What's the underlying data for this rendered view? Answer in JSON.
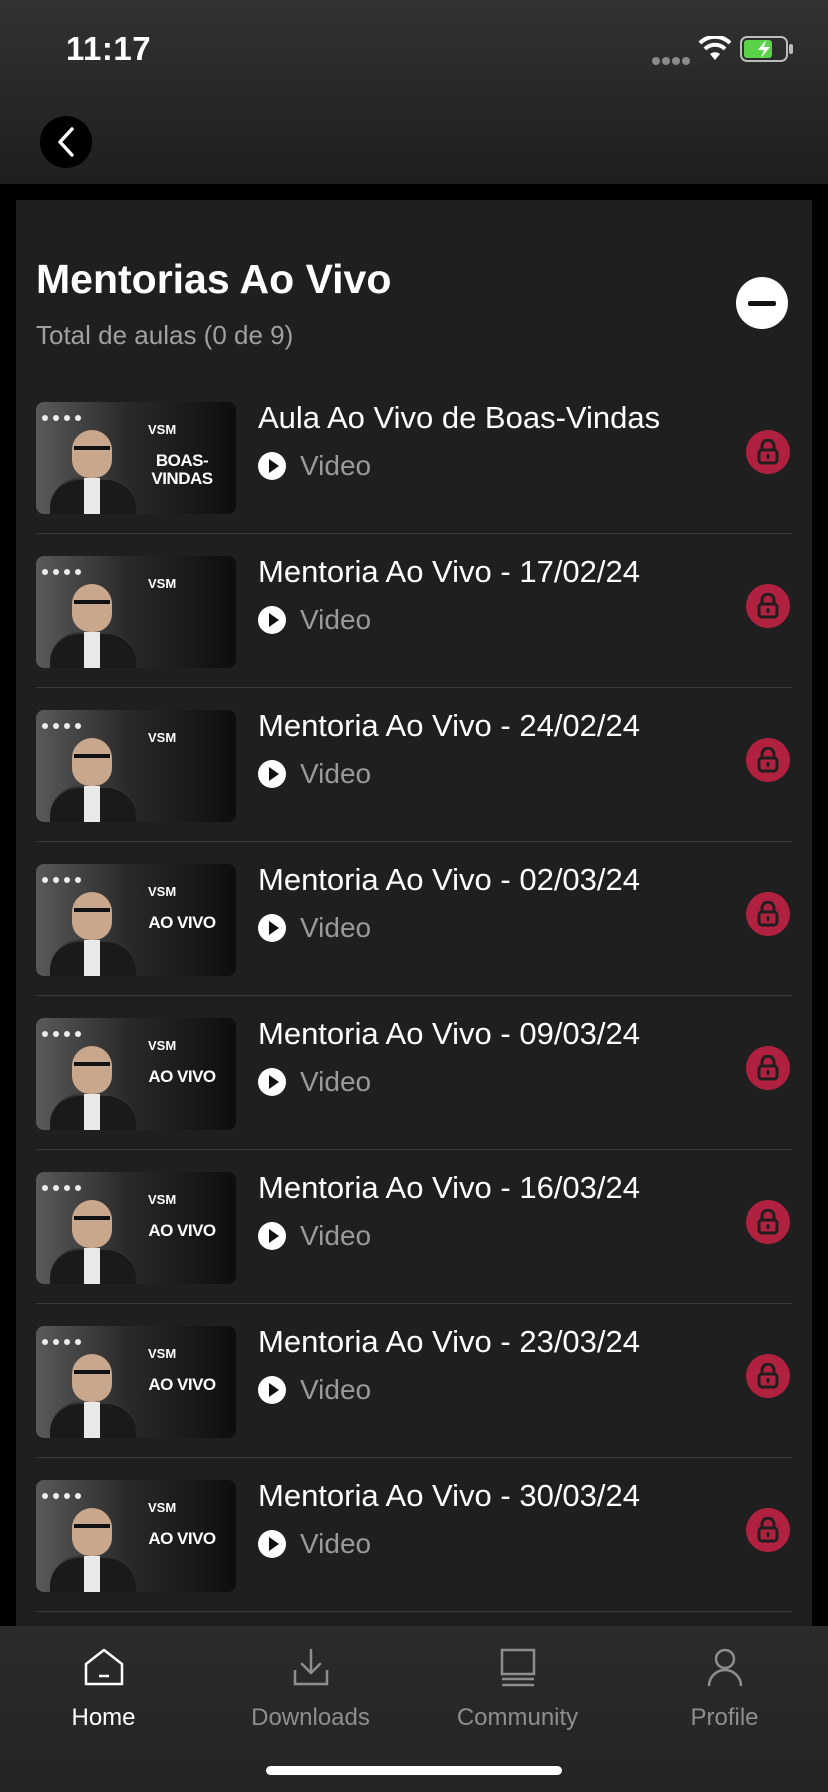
{
  "status_bar": {
    "time": "11:17"
  },
  "section": {
    "title": "Mentorias Ao Vivo",
    "subtitle": "Total de aulas (0 de 9)"
  },
  "lessons": [
    {
      "title": "Aula Ao Vivo de Boas-Vindas",
      "type": "Video",
      "thumb_caption": "BOAS-VINDAS",
      "thumb_logo": "VSM"
    },
    {
      "title": "Mentoria Ao Vivo - 17/02/24",
      "type": "Video",
      "thumb_caption": "",
      "thumb_logo": "VSM"
    },
    {
      "title": "Mentoria Ao Vivo - 24/02/24",
      "type": "Video",
      "thumb_caption": "",
      "thumb_logo": "VSM"
    },
    {
      "title": "Mentoria Ao Vivo - 02/03/24",
      "type": "Video",
      "thumb_caption": "AO VIVO",
      "thumb_logo": "VSM"
    },
    {
      "title": "Mentoria Ao Vivo - 09/03/24",
      "type": "Video",
      "thumb_caption": "AO VIVO",
      "thumb_logo": "VSM"
    },
    {
      "title": "Mentoria Ao Vivo - 16/03/24",
      "type": "Video",
      "thumb_caption": "AO VIVO",
      "thumb_logo": "VSM"
    },
    {
      "title": "Mentoria Ao Vivo - 23/03/24",
      "type": "Video",
      "thumb_caption": "AO VIVO",
      "thumb_logo": "VSM"
    },
    {
      "title": "Mentoria Ao Vivo - 30/03/24",
      "type": "Video",
      "thumb_caption": "AO VIVO",
      "thumb_logo": "VSM"
    }
  ],
  "tabbar": {
    "items": [
      {
        "label": "Home",
        "icon": "home-icon",
        "active": true
      },
      {
        "label": "Downloads",
        "icon": "download-icon",
        "active": false
      },
      {
        "label": "Community",
        "icon": "community-icon",
        "active": false
      },
      {
        "label": "Profile",
        "icon": "profile-icon",
        "active": false
      }
    ]
  },
  "colors": {
    "lock_badge": "#b0203f",
    "panel": "#1f1f1f",
    "background": "#000000"
  }
}
